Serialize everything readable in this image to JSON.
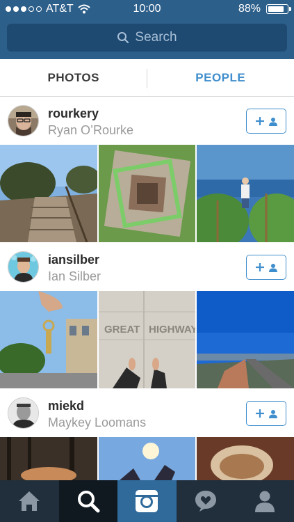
{
  "status_bar": {
    "carrier": "AT&T",
    "time": "10:00",
    "battery_percent_label": "88%",
    "battery_level": 0.88,
    "signal_bars": 3
  },
  "search": {
    "placeholder": "Search"
  },
  "tabs": [
    {
      "label": "PHOTOS",
      "active": false
    },
    {
      "label": "PEOPLE",
      "active": true
    }
  ],
  "users": [
    {
      "username": "rourkery",
      "full_name": "Ryan O’Rourke"
    },
    {
      "username": "iansilber",
      "full_name": "Ian Silber"
    },
    {
      "username": "miekd",
      "full_name": "Maykey Loomans"
    }
  ],
  "tab_bar": {
    "items": [
      "home-icon",
      "search-icon",
      "camera-icon",
      "activity-heart-icon",
      "profile-icon"
    ],
    "active": "search-icon"
  },
  "colors": {
    "header": "#2d5f8b",
    "accent": "#3f8ecd",
    "tab_bar": "#212f3c"
  }
}
